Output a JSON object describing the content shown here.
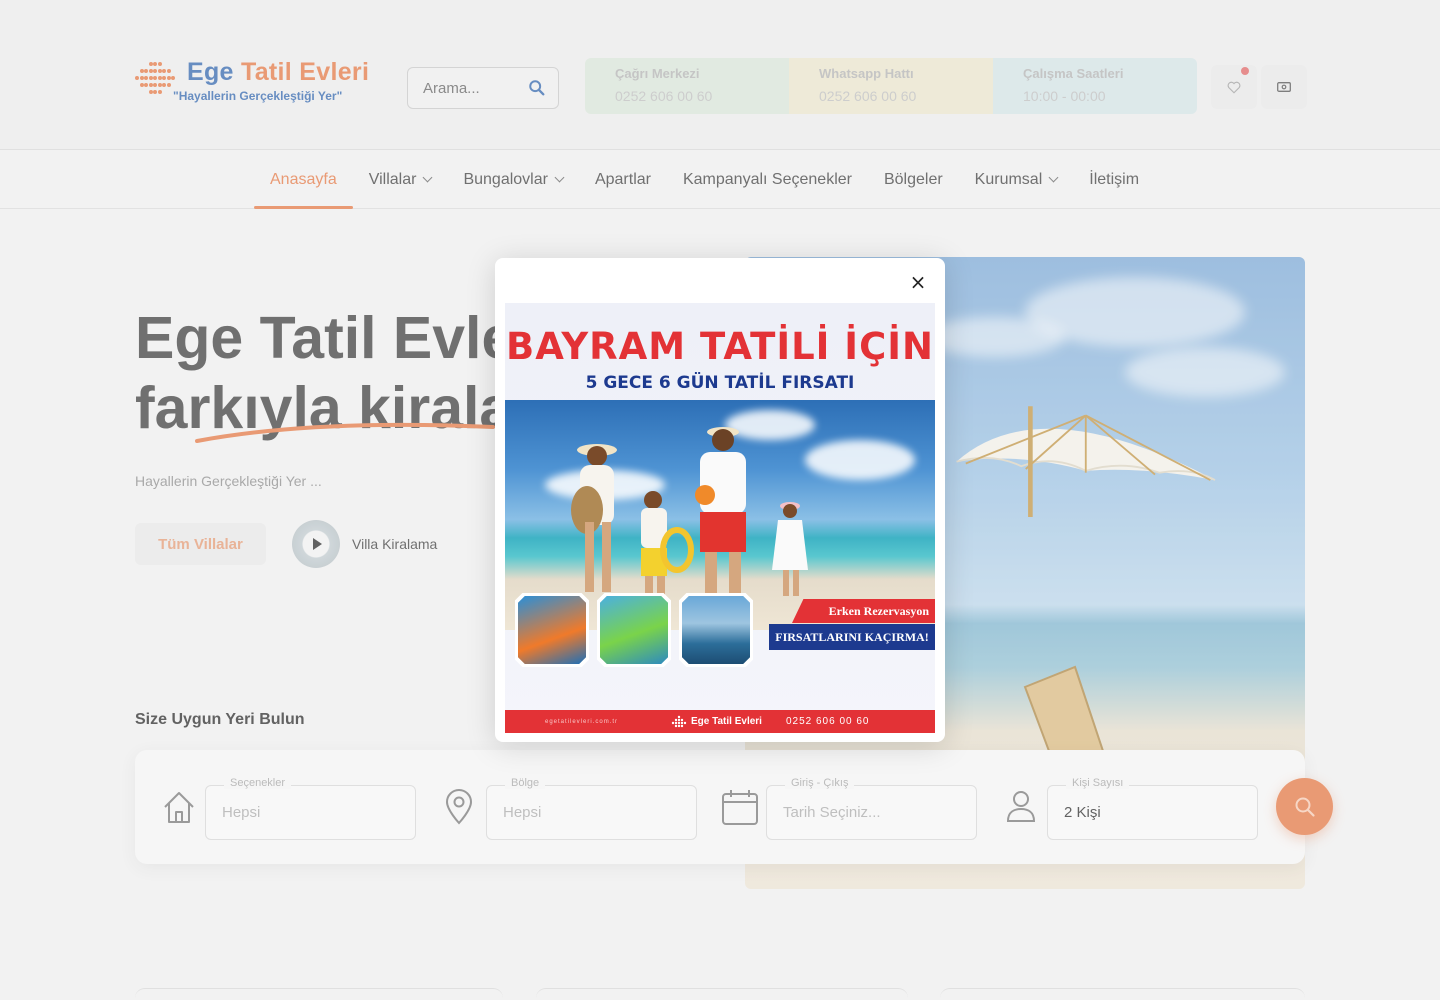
{
  "brand": {
    "name_part1": "Ege",
    "name_part2": "Tatil Evleri",
    "slogan": "\"Hayallerin Gerçekleştiği Yer\""
  },
  "header": {
    "search_placeholder": "Arama...",
    "info": [
      {
        "label": "Çağrı Merkezi",
        "value": "0252 606 00 60"
      },
      {
        "label": "Whatsapp Hattı",
        "value": "0252 606 00 60"
      },
      {
        "label": "Çalışma Saatleri",
        "value": "10:00 - 00:00"
      }
    ]
  },
  "nav": {
    "items": [
      {
        "label": "Anasayfa",
        "active": true,
        "dropdown": false
      },
      {
        "label": "Villalar",
        "active": false,
        "dropdown": true
      },
      {
        "label": "Bungalovlar",
        "active": false,
        "dropdown": true
      },
      {
        "label": "Apartlar",
        "active": false,
        "dropdown": false
      },
      {
        "label": "Kampanyalı Seçenekler",
        "active": false,
        "dropdown": false
      },
      {
        "label": "Bölgeler",
        "active": false,
        "dropdown": false
      },
      {
        "label": "Kurumsal",
        "active": false,
        "dropdown": true
      },
      {
        "label": "İletişim",
        "active": false,
        "dropdown": false
      }
    ]
  },
  "hero": {
    "title_line1": "Ege Tatil Evleri",
    "title_line2": "farkıyla kiralayın",
    "subtitle": "Hayallerin Gerçekleştiği Yer ...",
    "primary_button": "Tüm Villalar",
    "video_label": "Villa Kiralama"
  },
  "finder": {
    "title": "Size Uygun Yeri Bulun",
    "fields": [
      {
        "legend": "Seçenekler",
        "value": "Hepsi"
      },
      {
        "legend": "Bölge",
        "value": "Hepsi"
      },
      {
        "legend": "Giriş - Çıkış",
        "value": "Tarih Seçiniz..."
      },
      {
        "legend": "Kişi Sayısı",
        "value": "2 Kişi"
      }
    ]
  },
  "popup": {
    "close": "×",
    "headline": "BAYRAM TATİLİ İÇİN",
    "subheadline": "5 GECE 6 GÜN TATİL FIRSATI",
    "tag1": "Erken Rezervasyon",
    "tag2": "FIRSATLARINI KAÇIRMA!",
    "footer_url": "egetatilevleri.com.tr",
    "footer_brand": "Ege Tatil Evleri",
    "footer_phone": "0252 606 00 60"
  },
  "colors": {
    "accent": "#e8885a",
    "brand_blue": "#4a78b8",
    "promo_red": "#e33236",
    "promo_navy": "#1d3a8f"
  }
}
